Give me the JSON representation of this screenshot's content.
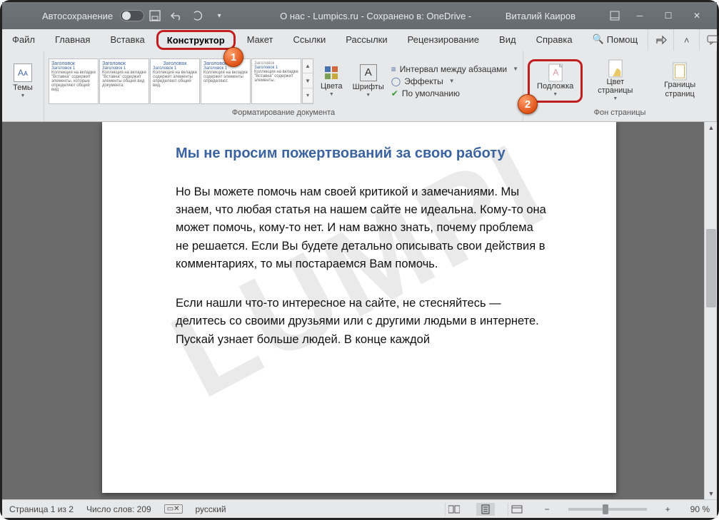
{
  "titlebar": {
    "autosave_label": "Автосохранение",
    "doc_title": "О нас - Lumpics.ru - Сохранено в: OneDrive -",
    "user_name": "Виталий Каиров"
  },
  "tabs": {
    "file": "Файл",
    "home": "Главная",
    "insert": "Вставка",
    "design": "Конструктор",
    "layout": "Макет",
    "references": "Ссылки",
    "mailings": "Рассылки",
    "review": "Рецензирование",
    "view": "Вид",
    "help": "Справка",
    "tellme": "Помощ"
  },
  "callouts": {
    "one": "1",
    "two": "2"
  },
  "ribbon": {
    "themes": "Темы",
    "style_title": "Заголовок",
    "style_sub": "Заголовок 1",
    "group_formatting": "Форматирование документа",
    "colors": "Цвета",
    "fonts": "Шрифты",
    "paragraph_spacing": "Интервал между абзацами",
    "effects": "Эффекты",
    "set_default": "По умолчанию",
    "watermark": "Подложка",
    "page_color": "Цвет страницы",
    "page_borders": "Границы страниц",
    "group_page_bg": "Фон страницы"
  },
  "document": {
    "watermark_text": "LUMPI",
    "heading": "Мы не просим пожертвований за свою работу",
    "para1": "Но Вы можете помочь нам своей критикой и замечаниями. Мы знаем, что любая статья на нашем сайте не идеальна. Кому-то она может помочь, кому-то нет. И нам важно знать, почему проблема не решается. Если Вы будете детально описывать свои действия в комментариях, то мы постараемся Вам помочь.",
    "para2": "Если нашли что-то интересное на сайте, не стесняйтесь — делитесь со своими друзьями или с другими людьми в интернете. Пускай узнает больше людей. В конце каждой"
  },
  "status": {
    "page": "Страница 1 из 2",
    "words": "Число слов: 209",
    "lang": "русский",
    "zoom": "90 %"
  }
}
